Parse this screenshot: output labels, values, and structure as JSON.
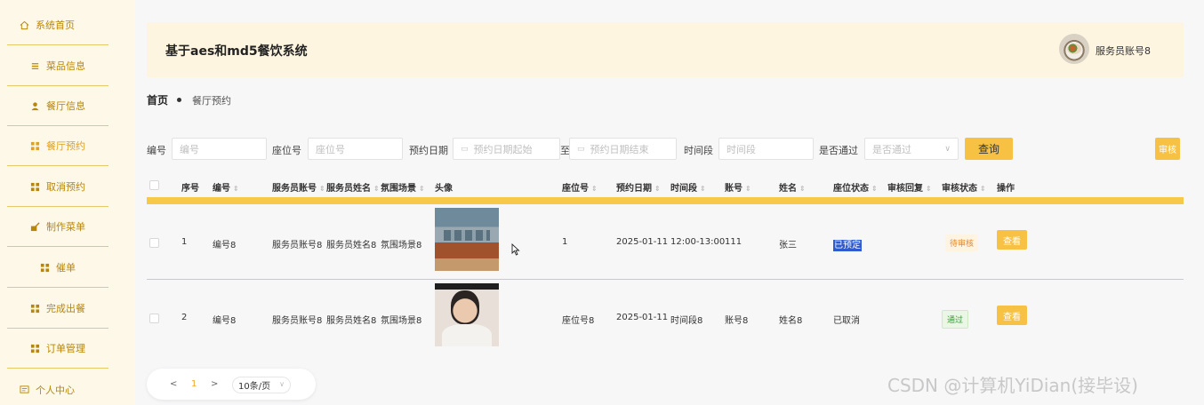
{
  "sidebar": {
    "items": [
      {
        "label": "系统首页",
        "icon": "home-icon"
      },
      {
        "label": "菜品信息",
        "icon": "list-icon"
      },
      {
        "label": "餐厅信息",
        "icon": "user-icon"
      },
      {
        "label": "餐厅预约",
        "icon": "grid-icon",
        "active": true
      },
      {
        "label": "取消预约",
        "icon": "grid-icon"
      },
      {
        "label": "制作菜单",
        "icon": "edit-icon"
      },
      {
        "label": "催单",
        "icon": "grid-icon"
      },
      {
        "label": "完成出餐",
        "icon": "grid-icon"
      },
      {
        "label": "订单管理",
        "icon": "grid-icon"
      },
      {
        "label": "个人中心",
        "icon": "profile-icon"
      }
    ]
  },
  "header": {
    "title": "基于aes和md5餐饮系统",
    "user": "服务员账号8"
  },
  "breadcrumb": {
    "home": "首页",
    "current": "餐厅预约"
  },
  "search": {
    "id_label": "编号",
    "id_placeholder": "编号",
    "seat_label": "座位号",
    "seat_placeholder": "座位号",
    "date_label": "预约日期",
    "date_start_placeholder": "预约日期起始",
    "date_sep": "至",
    "date_end_placeholder": "预约日期结束",
    "period_label": "时间段",
    "period_placeholder": "时间段",
    "pass_label": "是否通过",
    "pass_placeholder": "是否通过",
    "query_button": "查询",
    "review_button": "审核"
  },
  "table": {
    "columns": [
      "序号",
      "编号",
      "服务员账号",
      "服务员姓名",
      "氛围场景",
      "头像",
      "座位号",
      "预约日期",
      "时间段",
      "账号",
      "姓名",
      "座位状态",
      "审核回复",
      "审核状态",
      "操作"
    ],
    "rows": [
      {
        "index": "1",
        "id": "编号8",
        "waiter_account": "服务员账号8",
        "waiter_name": "服务员姓名8",
        "scene": "氛围场景8",
        "seat": "1",
        "date": "2025-01-11",
        "period": "12:00-13:00",
        "account": "111",
        "name": "张三",
        "seat_status": "已预定",
        "reply": "",
        "review_status": "待审核",
        "action": "查看"
      },
      {
        "index": "2",
        "id": "编号8",
        "waiter_account": "服务员账号8",
        "waiter_name": "服务员姓名8",
        "scene": "氛围场景8",
        "seat": "座位号8",
        "date": "2025-01-11",
        "period": "时间段8",
        "account": "账号8",
        "name": "姓名8",
        "seat_status": "已取消",
        "reply": "",
        "review_status": "通过",
        "action": "查看"
      }
    ]
  },
  "pagination": {
    "prev": "<",
    "current": "1",
    "next": ">",
    "page_size": "10条/页"
  },
  "watermark": "CSDN @计算机YiDian(接毕设)",
  "colors": {
    "accent": "#f7c244",
    "sidebar_bg": "#fdf8e8",
    "header_bg": "#fdf5e0",
    "sidebar_text": "#b8860b"
  }
}
